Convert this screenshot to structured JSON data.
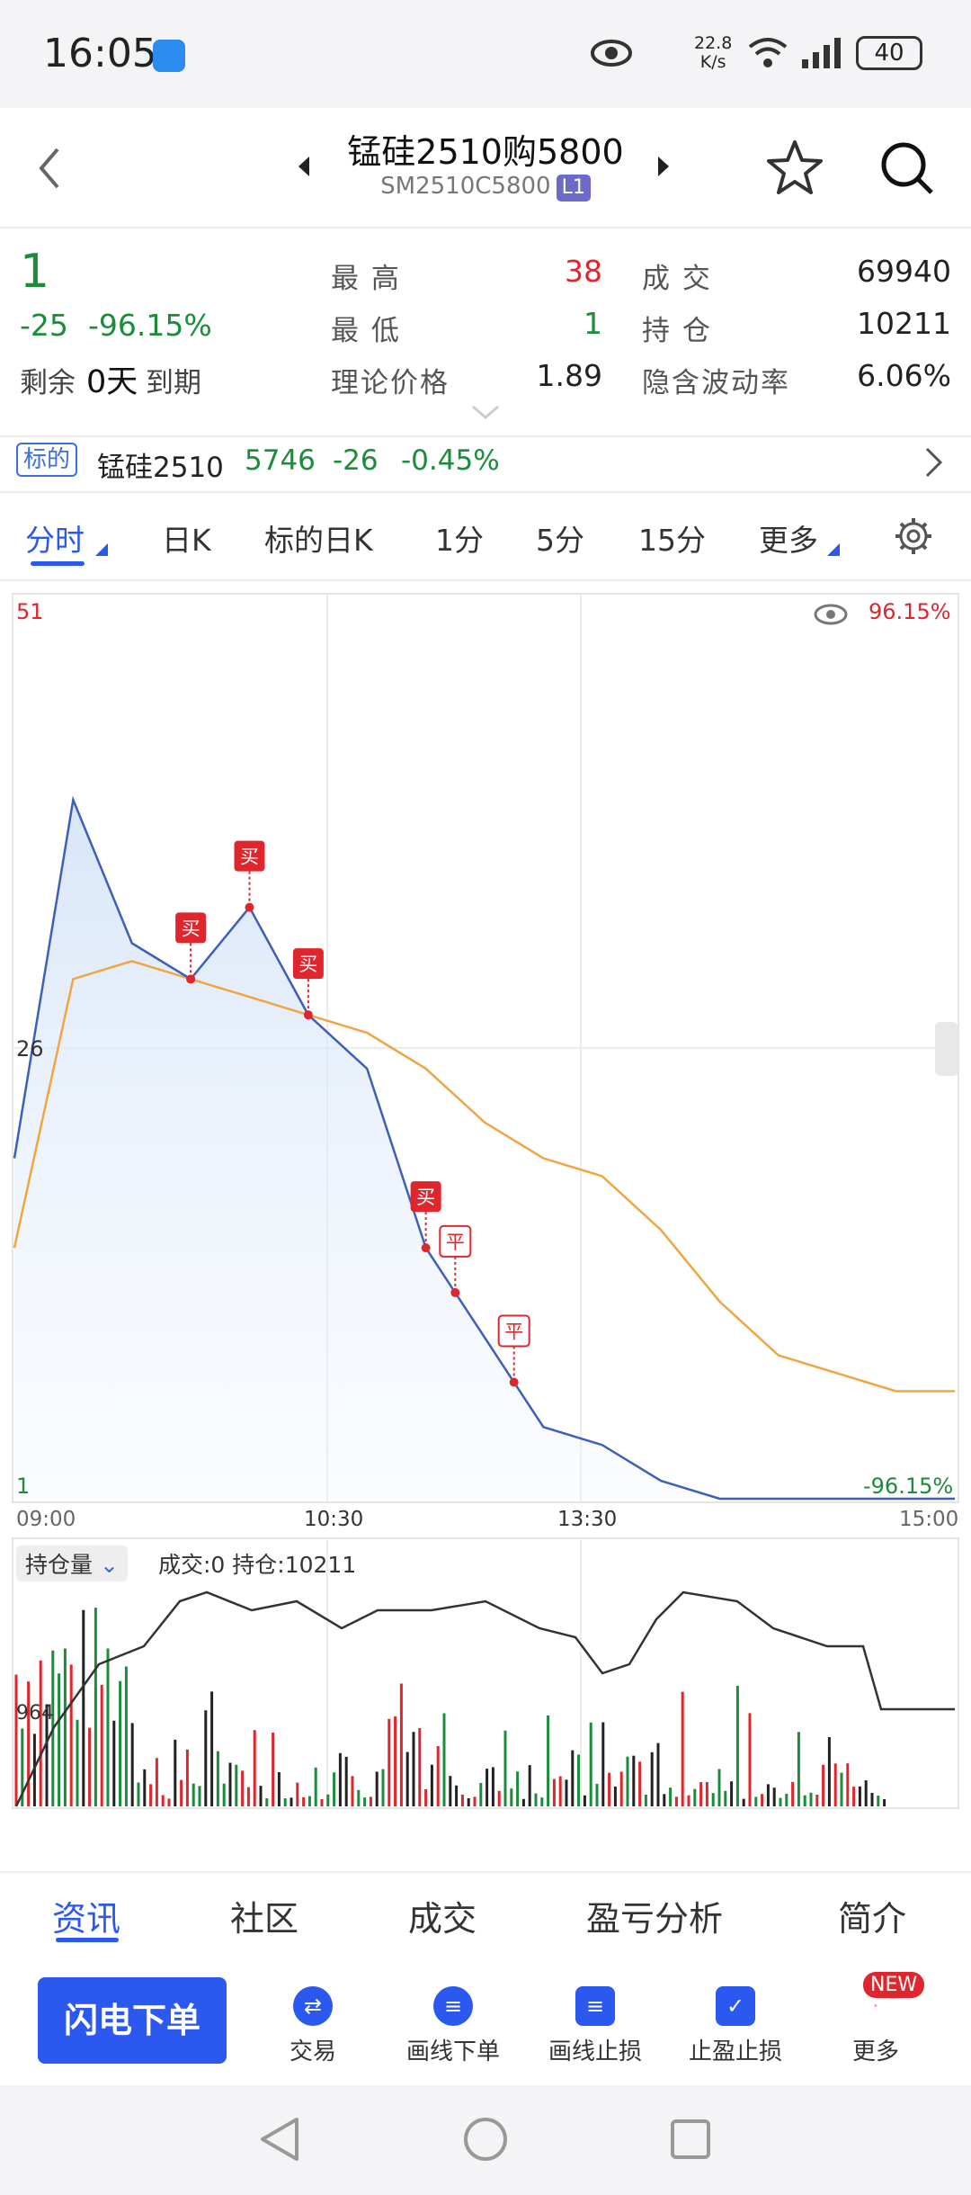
{
  "status_bar": {
    "time": "16:05",
    "net_speed": "22.8",
    "net_unit": "K/s",
    "signal_label": "6",
    "battery": "40"
  },
  "header": {
    "title": "锰硅2510购5800",
    "code": "SM2510C5800",
    "level_badge": "L1"
  },
  "quote": {
    "price": "1",
    "change": "-25",
    "change_pct": "-96.15%",
    "remaining_label": "剩余",
    "remaining_days": "0天",
    "expiry_label": "到期",
    "high_label": "最 高",
    "high": "38",
    "low_label": "最 低",
    "low": "1",
    "theo_label": "理论价格",
    "theo": "1.89",
    "volume_label": "成 交",
    "volume": "69940",
    "oi_label": "持 仓",
    "oi": "10211",
    "iv_label": "隐含波动率",
    "iv": "6.06%"
  },
  "underlying": {
    "tag": "标的",
    "name": "锰硅2510",
    "price": "5746",
    "change": "-26",
    "change_pct": "-0.45%"
  },
  "tabs": [
    "分时",
    "日K",
    "标的日K",
    "1分",
    "5分",
    "15分",
    "更多"
  ],
  "chart": {
    "y_max_label": "51",
    "y_mid_label": "26",
    "y_min_label": "1",
    "pct_top": "96.15%",
    "pct_bottom": "-96.15%",
    "times": [
      "09:00",
      "10:30",
      "13:30",
      "15:00"
    ],
    "markers": [
      "买",
      "买",
      "买",
      "买",
      "平",
      "平"
    ],
    "sub_selector": "持仓量",
    "sub_info": "成交:0 持仓:10211",
    "sub_y_label": "964"
  },
  "chart_data": {
    "type": "line",
    "x": [
      "09:00",
      "09:15",
      "09:30",
      "09:45",
      "10:00",
      "10:15",
      "10:30",
      "10:45",
      "11:00",
      "11:15",
      "13:30",
      "13:45",
      "14:00",
      "14:15",
      "14:30",
      "14:45",
      "15:00"
    ],
    "series": [
      {
        "values": [
          20,
          40,
          32,
          30,
          34,
          28,
          25,
          15,
          10,
          5,
          4,
          2,
          1,
          1,
          1,
          1,
          1
        ]
      },
      {
        "values": [
          15,
          30,
          31,
          30,
          29,
          28,
          27,
          25,
          22,
          20,
          19,
          16,
          12,
          9,
          8,
          7,
          7
        ]
      }
    ],
    "ylim": [
      1,
      51
    ]
  },
  "bottom_tabs": [
    "资讯",
    "社区",
    "成交",
    "盈亏分析",
    "简介"
  ],
  "actions": {
    "flash": "闪电下单",
    "items": [
      "交易",
      "画线下单",
      "画线止损",
      "止盈止损",
      "更多"
    ],
    "new_badge": "NEW"
  }
}
